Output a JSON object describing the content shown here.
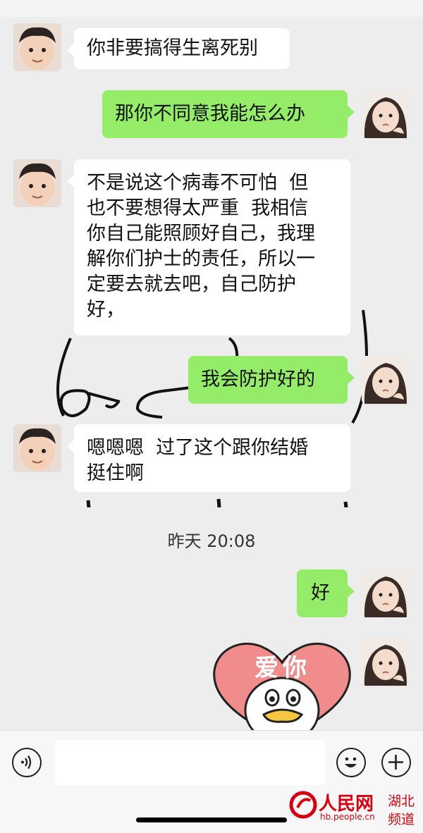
{
  "messages": [
    {
      "side": "in",
      "text": "你非要搞得生离死别"
    },
    {
      "side": "out",
      "text": "那你不同意我能怎么办"
    },
    {
      "side": "in",
      "text": "不是说这个病毒不可怕  但\n也不要想得太严重  我相信\n你自己能照顾好自己，我理\n解你们护士的责任，所以一\n定要去就去吧，自己防护\n好，"
    },
    {
      "side": "out",
      "text": "我会防护好的"
    },
    {
      "side": "in",
      "text": "嗯嗯嗯  过了这个跟你结婚\n挺住啊"
    },
    {
      "side": "out",
      "text": "好"
    }
  ],
  "timestamp": "昨天 20:08",
  "sticker": {
    "text": "爱你",
    "name": "heart-duck-sticker"
  },
  "input_bar": {
    "voice_icon": "voice-icon",
    "emoji_icon": "emoji-icon",
    "plus_icon": "plus-icon"
  },
  "watermark": {
    "logo": "人民网",
    "url": "hb.people.cn",
    "channel_line1": "湖北",
    "channel_line2": "频道"
  },
  "colors": {
    "bubble_out": "#95ec69",
    "bubble_in": "#ffffff",
    "background": "#ededed",
    "watermark_red": "#d7000f"
  }
}
